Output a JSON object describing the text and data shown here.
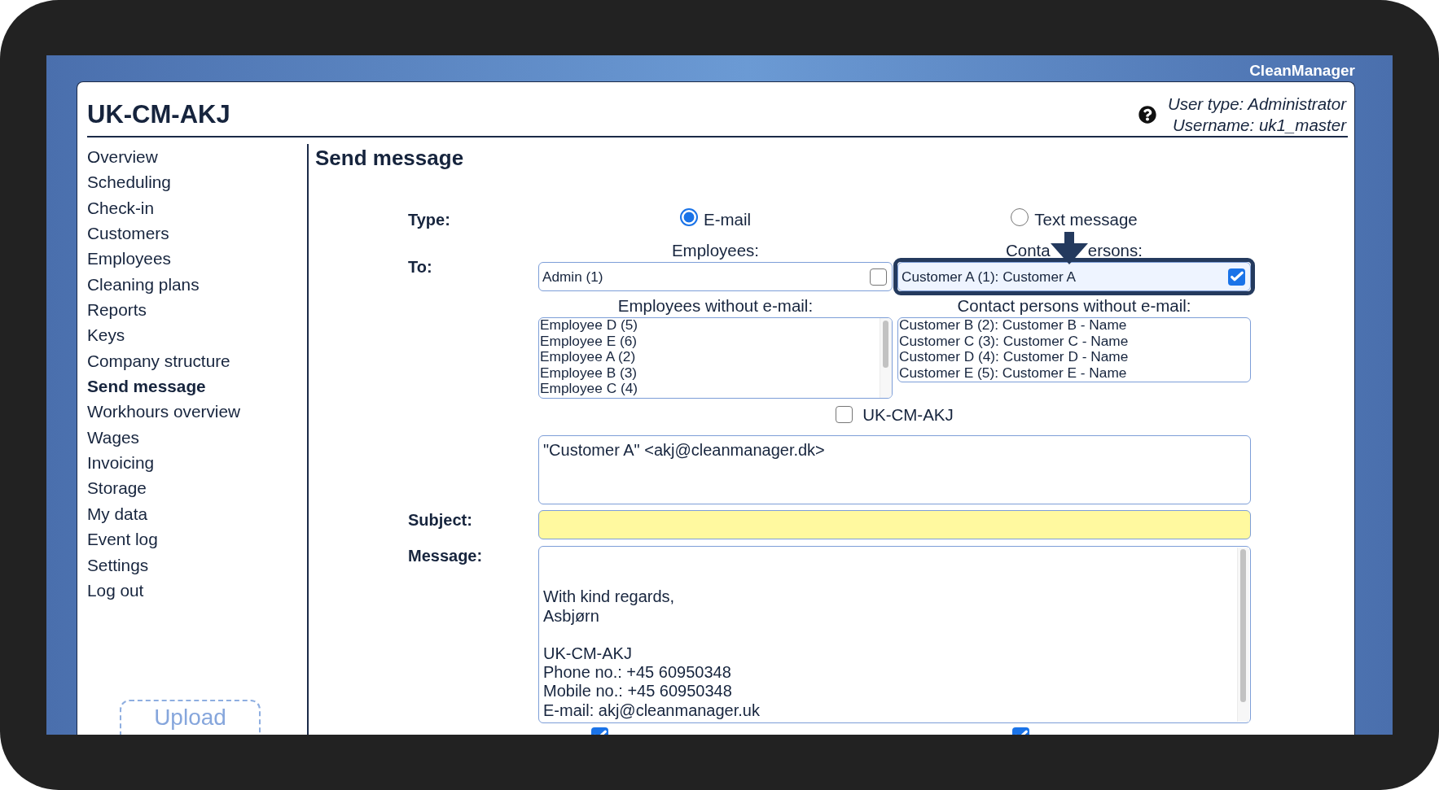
{
  "brand": "CleanManager",
  "header": {
    "title": "UK-CM-AKJ",
    "user_type": "User type: Administrator",
    "username": "Username: uk1_master"
  },
  "sidebar": {
    "items": [
      {
        "label": "Overview",
        "selected": false
      },
      {
        "label": "Scheduling",
        "selected": false
      },
      {
        "label": "Check-in",
        "selected": false
      },
      {
        "label": "Customers",
        "selected": false
      },
      {
        "label": "Employees",
        "selected": false
      },
      {
        "label": "Cleaning plans",
        "selected": false
      },
      {
        "label": "Reports",
        "selected": false
      },
      {
        "label": "Keys",
        "selected": false
      },
      {
        "label": "Company structure",
        "selected": false
      },
      {
        "label": "Send message",
        "selected": true
      },
      {
        "label": "Workhours overview",
        "selected": false
      },
      {
        "label": "Wages",
        "selected": false
      },
      {
        "label": "Invoicing",
        "selected": false
      },
      {
        "label": "Storage",
        "selected": false
      },
      {
        "label": "My data",
        "selected": false
      },
      {
        "label": "Event log",
        "selected": false
      },
      {
        "label": "Settings",
        "selected": false
      },
      {
        "label": "Log out",
        "selected": false
      }
    ],
    "upload_button": "Upload"
  },
  "page_title": "Send message",
  "form": {
    "type": {
      "label": "Type:",
      "options": [
        {
          "label": "E-mail",
          "selected": true
        },
        {
          "label": "Text message",
          "selected": false
        }
      ]
    },
    "to": {
      "label": "To:",
      "groups": [
        {
          "heading_parts": [
            "Employees:"
          ],
          "highlighted": false,
          "recipients": [
            {
              "name": "Admin (1)",
              "checked": false
            }
          ],
          "without_email_heading": "Employees without e-mail:",
          "without_email": [
            "Employee D (5)",
            "Employee E (6)",
            "Employee A (2)",
            "Employee B (3)",
            "Employee C (4)"
          ]
        },
        {
          "heading_parts": [
            "Conta",
            "ersons:"
          ],
          "highlighted": true,
          "recipients": [
            {
              "name": "Customer A (1): Customer A",
              "checked": true
            }
          ],
          "without_email_heading": "Contact persons without e-mail:",
          "without_email": [
            "Customer B (2): Customer B - Name",
            "Customer C (3): Customer C - Name",
            "Customer D (4): Customer D - Name",
            "Customer E (5): Customer E - Name"
          ]
        }
      ]
    },
    "company": {
      "label": "UK-CM-AKJ",
      "checked": false
    },
    "recipients_field": {
      "value": "\"Customer A\" <akj@cleanmanager.dk>"
    },
    "subject": {
      "label": "Subject:"
    },
    "message": {
      "label": "Message:",
      "value": "\n\nWith kind regards,\nAsbjørn\n\nUK-CM-AKJ\nPhone no.: +45 60950348\nMobile no.: +45 60950348\nE-mail: akj@cleanmanager.uk"
    },
    "bottom_checkboxes": [
      {
        "checked": true
      },
      {
        "checked": true
      }
    ]
  }
}
